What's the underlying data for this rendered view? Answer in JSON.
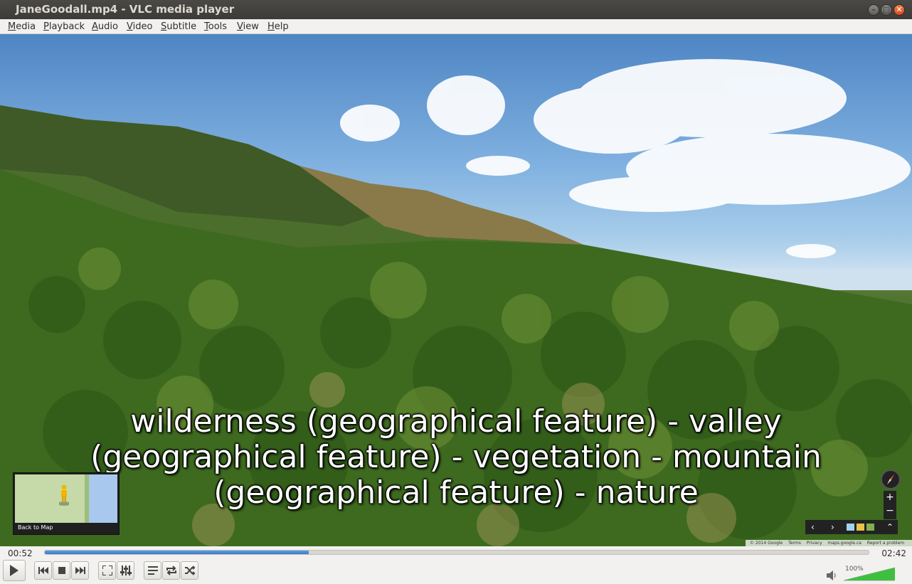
{
  "window": {
    "title": "JaneGoodall.mp4 - VLC media player"
  },
  "menu": [
    "Media",
    "Playback",
    "Audio",
    "Video",
    "Subtitle",
    "Tools",
    "View",
    "Help"
  ],
  "video": {
    "subtitle_lines": [
      "wilderness (geographical feature) - valley",
      "(geographical feature) - vegetation - mountain",
      "(geographical feature) - nature"
    ],
    "minimap_label": "Back to Map",
    "attribution": [
      "© 2014 Google",
      "Terms",
      "Privacy",
      "maps.google.ca",
      "Report a problem"
    ]
  },
  "playback": {
    "current_time": "00:52",
    "total_time": "02:42",
    "progress_fraction": 0.32
  },
  "controls": {
    "icons": [
      "play-icon",
      "previous-icon",
      "stop-icon",
      "next-icon",
      "fullscreen-icon",
      "extended-settings-icon",
      "playlist-icon",
      "loop-icon",
      "shuffle-icon"
    ]
  },
  "volume": {
    "label": "100%",
    "level_fraction": 1.0,
    "color": "#3fbf3f"
  }
}
